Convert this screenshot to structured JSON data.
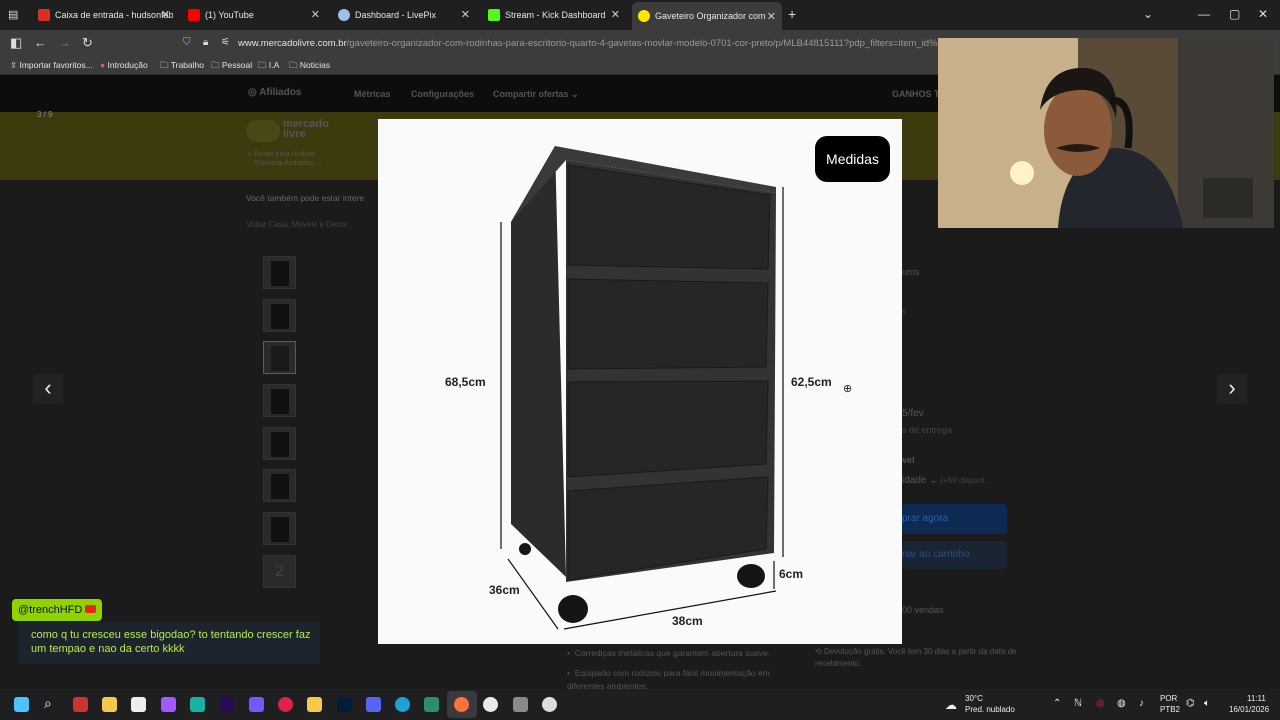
{
  "browser": {
    "tabs": [
      {
        "title": "Caixa de entrada - hudsonfabio",
        "color": "#d93025"
      },
      {
        "title": "(1) YouTube",
        "color": "#ff0000"
      },
      {
        "title": "Dashboard - LivePix",
        "color": "#9ac1e8"
      },
      {
        "title": "Stream - Kick Dashboard",
        "color": "#53fc18"
      },
      {
        "title": "Gaveteiro Organizador com Ro",
        "color": "#ffe600"
      }
    ],
    "new_tab": "+",
    "url_domain": "www.mercadolivre.com.br",
    "url_path": "/gaveteiro-organizador-com-rodinhas-para-escritorio-quarto-4-gavetas-movlar-modelo-0701-cor-preto/p/MLB44815111?pdp_filters=item_id%3AML",
    "bookmarks": [
      "Importar favoritos...",
      "Introdução",
      "Trabalho",
      "Pessoal",
      "I.A",
      "Noticias"
    ]
  },
  "page": {
    "affiliate_bar": {
      "brand": "Afiliados",
      "items": [
        "Métricas",
        "Configurações",
        "Compartir ofertas"
      ],
      "right": "GANHOS T"
    },
    "ml_logo": [
      "mercado",
      "livre"
    ],
    "location": [
      "Enviar para Hudson",
      "Travessa Andrades ..."
    ],
    "counter": "3 / 9",
    "also_label": "Você também pode estar intere",
    "breadcrumb": "Voltar   Casa, Móveis e Decor",
    "right_panel": [
      "uros",
      "s",
      "5/fev",
      "s de entrega",
      "vel",
      "idade",
      "(+50 disponí...",
      "prar agora",
      "nar ao carrinho",
      "00 vendas"
    ],
    "bullets": [
      "Corrediças metálicas que garantem abertura suave.",
      "Equipado com rodízios para fácil movimentação em diferentes ambientes."
    ],
    "return_text": "Devolução grátis. Você tem 30 dias a partir da data de recebimento.",
    "thumb_last": "2"
  },
  "modal": {
    "badge": "Medidas",
    "dims": {
      "left_height": "68,5cm",
      "right_height": "62,5cm",
      "wheel": "6cm",
      "depth": "36cm",
      "width": "38cm"
    }
  },
  "chat": {
    "user": "@trenchHFD",
    "message": "como q tu cresceu esse bigodao? to tentando crescer faz um tempao e nao da certo kkkk"
  },
  "taskbar": {
    "weather_temp": "30°C",
    "weather_desc": "Pred. nublado",
    "lang1": "POR",
    "lang2": "PTB2",
    "time": "11:11",
    "date": "16/01/2026"
  }
}
